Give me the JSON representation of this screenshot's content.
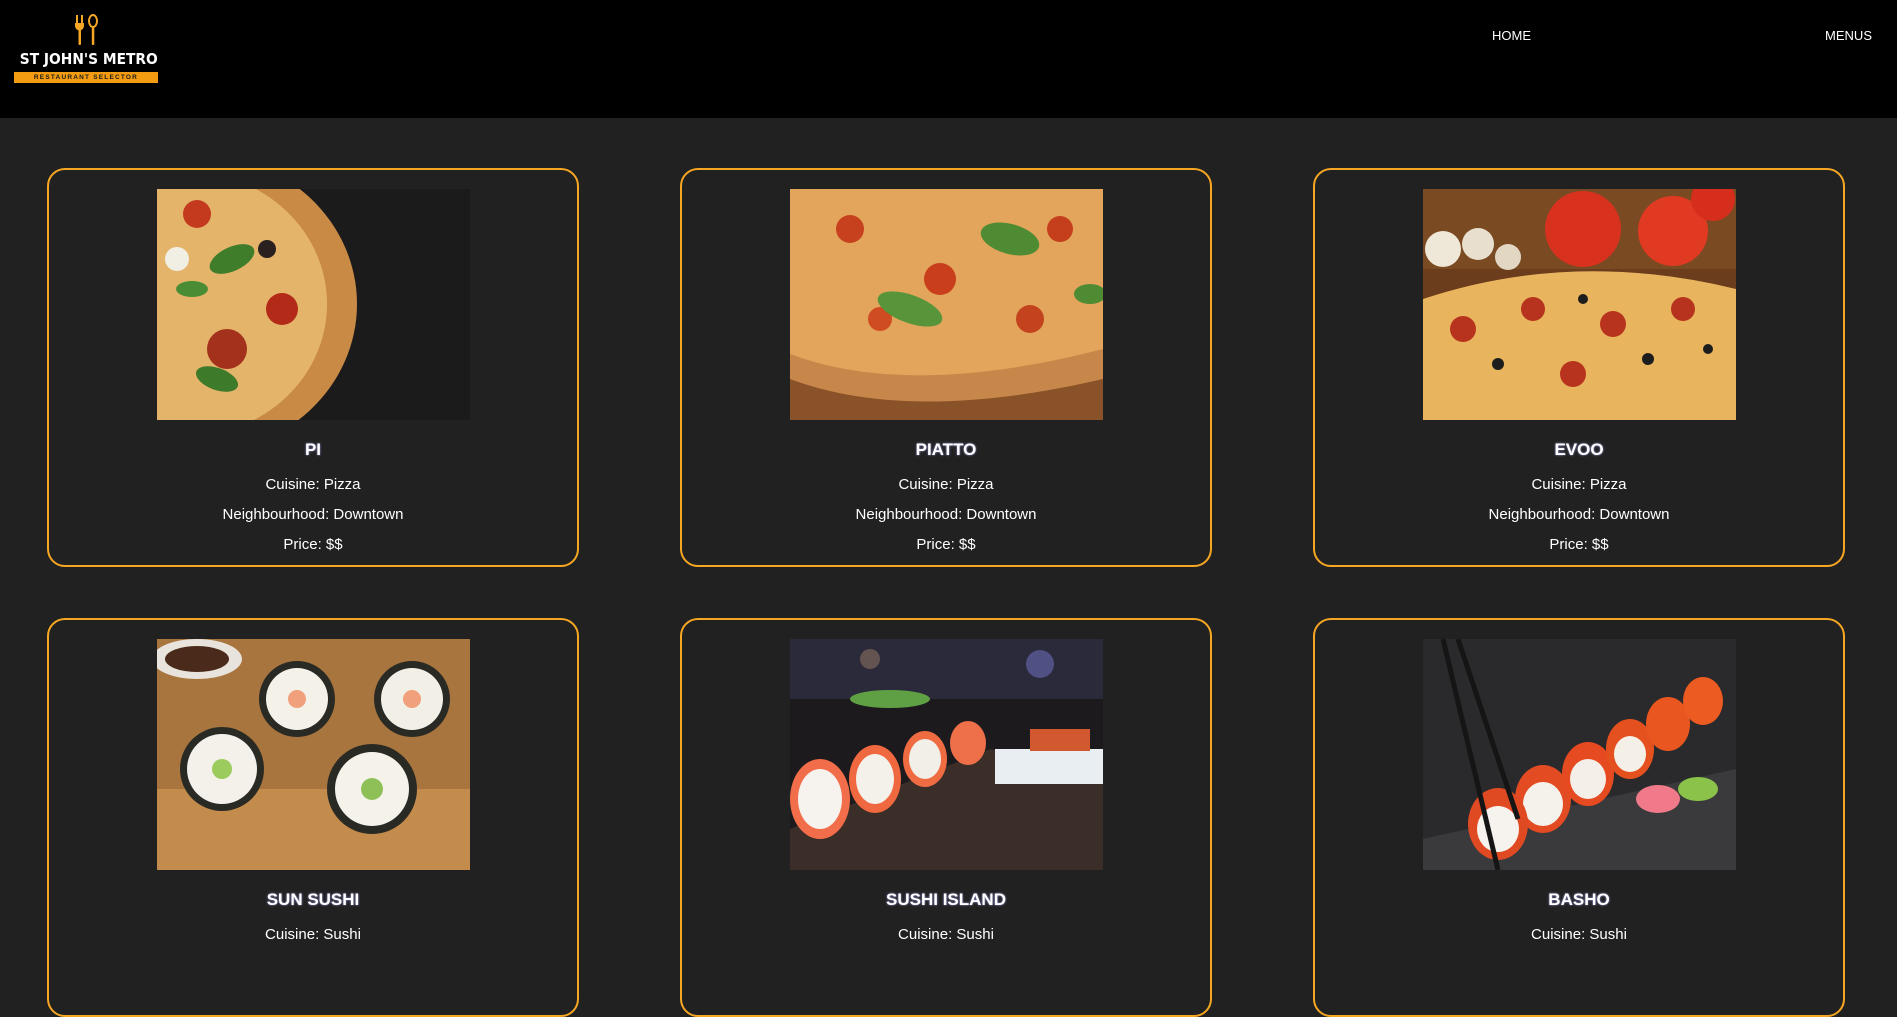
{
  "brand": {
    "title": "ST JOHN'S METRO",
    "subtitle": "RESTAURANT SELECTOR",
    "icon": "utensils-icon",
    "accent": "#f5a623"
  },
  "nav": {
    "home": "HOME",
    "menus": "MENUS"
  },
  "restaurants": [
    {
      "name": "PI",
      "cuisine": "Cuisine: Pizza",
      "neighbourhood": "Neighbourhood: Downtown",
      "price": "Price: $$",
      "image": "pizza-slice-photo"
    },
    {
      "name": "PIATTO",
      "cuisine": "Cuisine: Pizza",
      "neighbourhood": "Neighbourhood: Downtown",
      "price": "Price: $$",
      "image": "margherita-pizza-photo"
    },
    {
      "name": "EVOO",
      "cuisine": "Cuisine: Pizza",
      "neighbourhood": "Neighbourhood: Downtown",
      "price": "Price: $$",
      "image": "pepperoni-pizza-photo"
    },
    {
      "name": "SUN SUSHI",
      "cuisine": "Cuisine: Sushi",
      "image": "sushi-rolls-photo"
    },
    {
      "name": "SUSHI ISLAND",
      "cuisine": "Cuisine: Sushi",
      "image": "sushi-platter-photo"
    },
    {
      "name": "BASHO",
      "cuisine": "Cuisine: Sushi",
      "image": "salmon-roe-sushi-photo"
    }
  ]
}
